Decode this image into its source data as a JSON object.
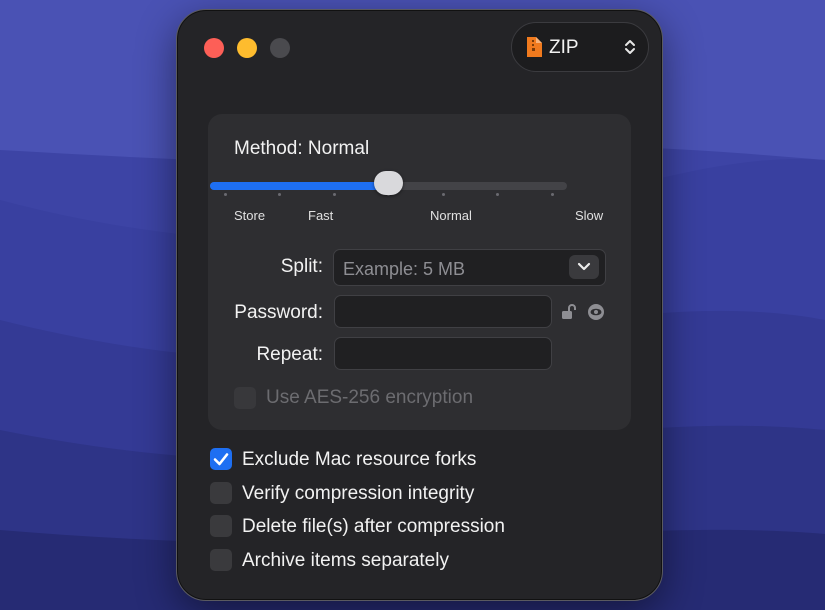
{
  "window": {
    "format_label": "ZIP",
    "icons": {
      "file": "zip-file-icon",
      "updown": "chevron-up-down-icon",
      "lock": "unlock-icon",
      "eye": "eye-icon",
      "dropdown": "chevron-down-icon"
    },
    "colors": {
      "accent": "#1e6ff2",
      "close": "#fd5f57",
      "minimize": "#febc2e"
    }
  },
  "method": {
    "label": "Method: Normal",
    "slider_levels": [
      "Store",
      "Fast",
      "Normal",
      "Slow"
    ],
    "selected_level": "Normal"
  },
  "split": {
    "label": "Split:",
    "placeholder": "Example: 5 MB"
  },
  "password": {
    "label": "Password:",
    "value": ""
  },
  "repeat": {
    "label": "Repeat:",
    "value": ""
  },
  "aes": {
    "label": "Use AES-256 encryption",
    "checked": false,
    "enabled": false
  },
  "options": [
    {
      "label": "Exclude Mac resource forks",
      "checked": true
    },
    {
      "label": "Verify compression integrity",
      "checked": false
    },
    {
      "label": "Delete file(s) after compression",
      "checked": false
    },
    {
      "label": "Archive items separately",
      "checked": false
    }
  ]
}
